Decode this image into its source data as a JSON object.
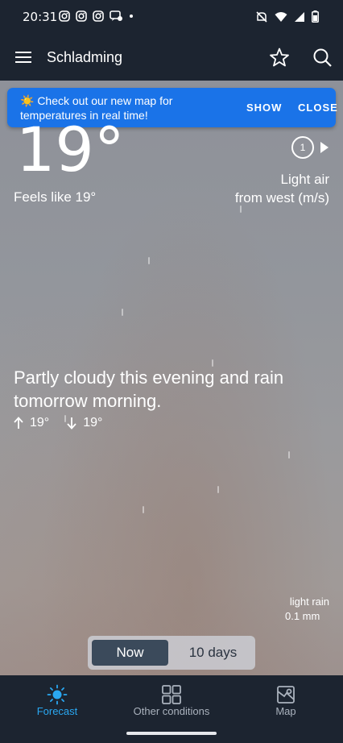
{
  "status_bar": {
    "time": "20:31",
    "left_icons": [
      "instagram-icon",
      "instagram-icon",
      "instagram-icon",
      "message-icon",
      "dot-icon"
    ],
    "right_icons": [
      "mute-icon",
      "wifi-icon",
      "signal-icon",
      "battery-icon"
    ]
  },
  "appbar": {
    "title": "Schladming",
    "icons": [
      "menu-icon",
      "star-icon",
      "search-icon"
    ]
  },
  "banner": {
    "text": "☀️ Check out our new map for temperatures in real time!",
    "show_label": "SHOW",
    "close_label": "CLOSE",
    "color": "#1a73e8"
  },
  "current": {
    "temperature": "19°",
    "feels_like": "Feels like 19°",
    "wind_speed": "1",
    "wind_line1": "Light air",
    "wind_line2": "from west (m/s)",
    "summary": "Partly cloudy this evening and rain tomorrow morning.",
    "high": "19°",
    "low": "19°",
    "precip_line1": "light rain",
    "precip_line2": "0.1 mm"
  },
  "toggle": {
    "now_label": "Now",
    "ten_days_label": "10 days",
    "selected": "Now"
  },
  "bottom_nav": {
    "items": [
      {
        "label": "Forecast",
        "icon": "sun-icon",
        "active": true
      },
      {
        "label": "Other conditions",
        "icon": "grid-icon",
        "active": false
      },
      {
        "label": "Map",
        "icon": "map-icon",
        "active": false
      }
    ],
    "active_color": "#2aa8f2"
  }
}
